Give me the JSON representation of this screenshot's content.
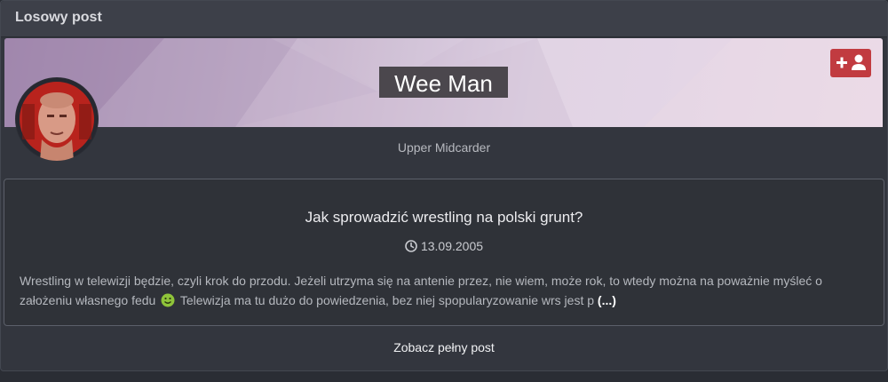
{
  "widget": {
    "title": "Losowy post"
  },
  "profile": {
    "name": "Wee Man",
    "rank": "Upper Midcarder",
    "follow_icon": "user-plus-icon",
    "avatar_icon": "wrestler-avatar"
  },
  "post": {
    "title": "Jak sprowadzić wrestling na polski grunt?",
    "date": "13.09.2005",
    "date_icon": "clock-icon",
    "excerpt_part1": "Wrestling w telewizji będzie, czyli krok do przodu. Jeżeli utrzyma się na antenie przez, nie wiem, może rok, to wtedy można na poważnie myśleć o założeniu własnego fedu",
    "excerpt_part2": "Telewizja ma tu dużo do powiedzenia, bez niej spopularyzowanie wrs jest p",
    "more": "(...)",
    "emoji_icon": "smiley-icon"
  },
  "footer": {
    "full_post_label": "Zobacz pełny post"
  },
  "colors": {
    "accent_red": "#c13b40",
    "background": "#33363e",
    "card": "#2f3238"
  }
}
